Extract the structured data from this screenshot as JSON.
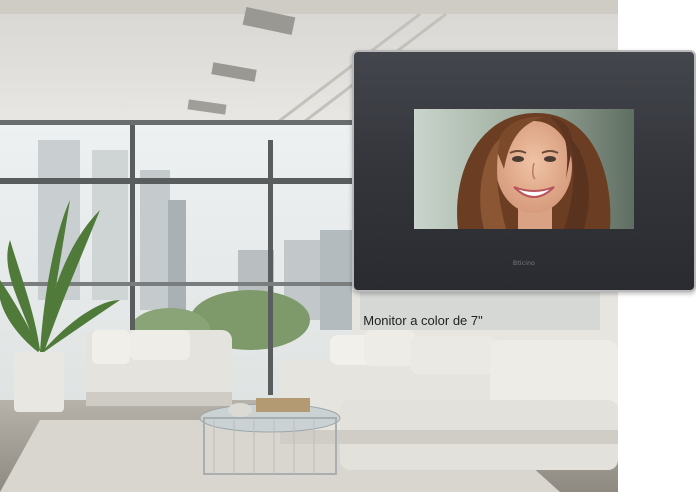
{
  "caption": {
    "text": "Monitor a color de 7\""
  },
  "monitor": {
    "brand_label": "Bticino"
  },
  "colors": {
    "monitor_frame": "#34363c",
    "bezel_silver": "#b9b9b9",
    "wall": "#e9e7e2",
    "sofa": "#e8e6e0"
  }
}
